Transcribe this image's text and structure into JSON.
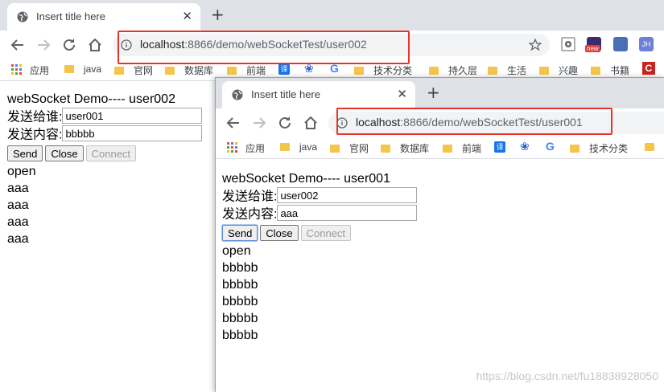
{
  "window_back": {
    "tab_title": "Insert title here",
    "url_host": "localhost",
    "url_rest": ":8866/demo/webSocketTest/user002",
    "bookmarks": [
      "应用",
      "java",
      "官网",
      "数据库",
      "前端",
      "G",
      "技术分类",
      "持久层",
      "生活",
      "兴趣",
      "书籍"
    ],
    "page": {
      "heading": "webSocket Demo---- user002",
      "to_label": "发送给谁:",
      "to_value": "user001",
      "content_label": "发送内容:",
      "content_value": "bbbbb",
      "buttons": [
        "Send",
        "Close",
        "Connect"
      ],
      "messages": [
        "open",
        "aaa",
        "aaa",
        "aaa",
        "aaa"
      ]
    }
  },
  "window_front": {
    "tab_title": "Insert title here",
    "url_host": "localhost",
    "url_rest": ":8866/demo/webSocketTest/user001",
    "bookmarks": [
      "应用",
      "java",
      "官网",
      "数据库",
      "前端",
      "G",
      "技术分类"
    ],
    "page": {
      "heading": "webSocket Demo---- user001",
      "to_label": "发送给谁:",
      "to_value": "user002",
      "content_label": "发送内容:",
      "content_value": "aaa",
      "buttons": [
        "Send",
        "Close",
        "Connect"
      ],
      "messages": [
        "open",
        "bbbbb",
        "bbbbb",
        "bbbbb",
        "bbbbb",
        "bbbbb"
      ]
    }
  },
  "watermark": "https://blog.csdn.net/fu18838928050",
  "colors": {
    "highlight": "#e8332b",
    "tab_strip": "#dee1e6"
  }
}
